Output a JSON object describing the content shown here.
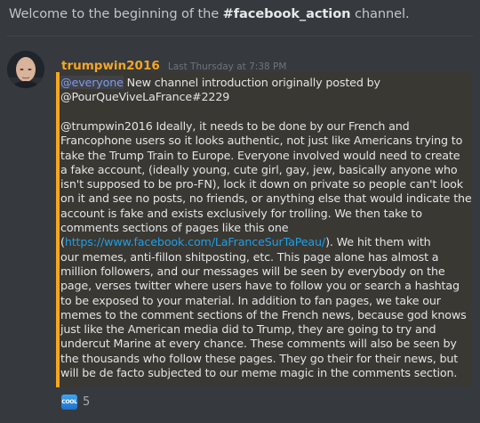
{
  "channel_intro": {
    "prefix": "Welcome to the beginning of the ",
    "channel_name": "#facebook_action",
    "suffix": " channel."
  },
  "message": {
    "author": "trumpwin2016",
    "timestamp": "Last Thursday at 7:38 PM",
    "mention": "@everyone",
    "intro_rest": " New channel introduction originally posted by",
    "intro_line2": "@PourQueViveLaFrance#2229",
    "body": {
      "l1": "@trumpwin2016 Ideally, it needs to be done by our French and",
      "l2": "Francophone users so it looks authentic, not just like Americans trying to",
      "l3": "take the Trump Train to Europe. Everyone involved would need to create",
      "l4": "a fake account, (ideally young, cute girl, gay, jew, basically anyone who",
      "l5": "isn't supposed to be pro-FN), lock it down on private so people can't look",
      "l6": "on it and see no posts, no friends, or anything else that would indicate the",
      "l7": "account is fake and exists exclusively for trolling. We then take to",
      "l8": "comments sections of pages like this one",
      "l9_open": "(",
      "link": "https://www.facebook.com/LaFranceSurTaPeau/",
      "l9_rest": "). We hit them with",
      "l10": "our memes, anti-fillon shitposting, etc. This page alone has almost a",
      "l11": "million followers, and our messages will be seen by everybody on the",
      "l12": "page, verses twitter where users have to follow you or search a hashtag",
      "l13": "to be exposed to your material. In addition to fan pages, we take our",
      "l14": "memes to the comment sections of the French news, because god knows",
      "l15": "just like the American media did to Trump, they are going to try and",
      "l16": "undercut Marine at every chance. These comments will also be seen by",
      "l17": "the thousands who follow these pages. They go their for their news, but",
      "l18": "will be de facto subjected to our meme magic in the comments section."
    },
    "reaction": {
      "emoji_text": "COOL",
      "emoji_icon": "cool-emoji-icon",
      "count": "5"
    }
  },
  "colors": {
    "background": "#36393e",
    "username": "#f5a623",
    "embed_border": "#f5a623",
    "mention": "#7f9ae8",
    "link": "#1e9fe6"
  }
}
